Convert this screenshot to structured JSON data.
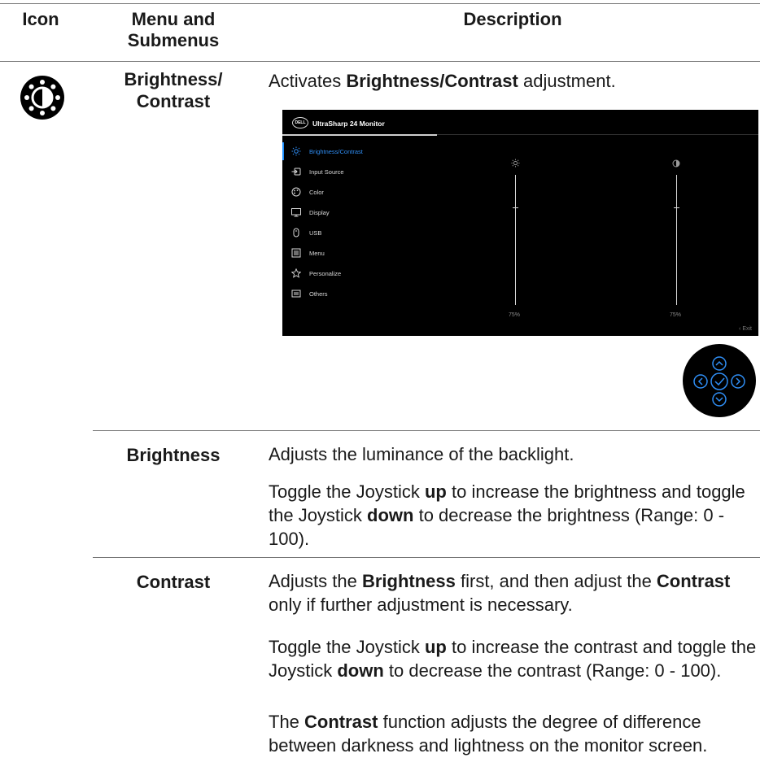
{
  "header": {
    "col_icon": "Icon",
    "col_menu": "Menu and Submenus",
    "col_desc": "Description"
  },
  "row_main": {
    "icon": "brightness-contrast-icon",
    "name": "Brightness/ Contrast",
    "desc_pre": "Activates ",
    "desc_bold": "Brightness/Contrast",
    "desc_post": " adjustment."
  },
  "osd": {
    "title": "UltraSharp 24 Monitor",
    "logo_text": "DELL",
    "menu": [
      {
        "label": "Brightness/Contrast",
        "icon": "sun-icon",
        "active": true
      },
      {
        "label": "Input Source",
        "icon": "input-source-icon",
        "active": false
      },
      {
        "label": "Color",
        "icon": "palette-icon",
        "active": false
      },
      {
        "label": "Display",
        "icon": "display-icon",
        "active": false
      },
      {
        "label": "USB",
        "icon": "mouse-icon",
        "active": false
      },
      {
        "label": "Menu",
        "icon": "menu-icon",
        "active": false
      },
      {
        "label": "Personalize",
        "icon": "star-icon",
        "active": false
      },
      {
        "label": "Others",
        "icon": "others-icon",
        "active": false
      }
    ],
    "brightness_value": "75%",
    "contrast_value": "75%",
    "brightness_level": 0.75,
    "contrast_level": 0.75,
    "exit_label": "Exit",
    "colors": {
      "accent": "#2f8ef5",
      "background": "#000000"
    }
  },
  "rows": {
    "brightness": {
      "name": "Brightness",
      "p1": "Adjusts the luminance of the backlight.",
      "p2_a": "Toggle the Joystick ",
      "p2_b": "up",
      "p2_c": " to increase the brightness and toggle the Joystick ",
      "p2_d": "down",
      "p2_e": " to decrease the brightness (Range: 0 - 100)."
    },
    "contrast": {
      "name": "Contrast",
      "p1_a": "Adjusts the ",
      "p1_b": "Brightness",
      "p1_c": " first, and then adjust the ",
      "p1_d": "Contrast",
      "p1_e": " only if further adjustment is necessary.",
      "p2_a": "Toggle the Joystick ",
      "p2_b": "up",
      "p2_c": " to increase the contrast and toggle the Joystick ",
      "p2_d": "down",
      "p2_e": " to decrease the contrast (Range: 0 - 100).",
      "p3_a": "The ",
      "p3_b": "Contrast",
      "p3_c": " function adjusts the degree of difference between darkness and lightness on the monitor screen."
    }
  }
}
